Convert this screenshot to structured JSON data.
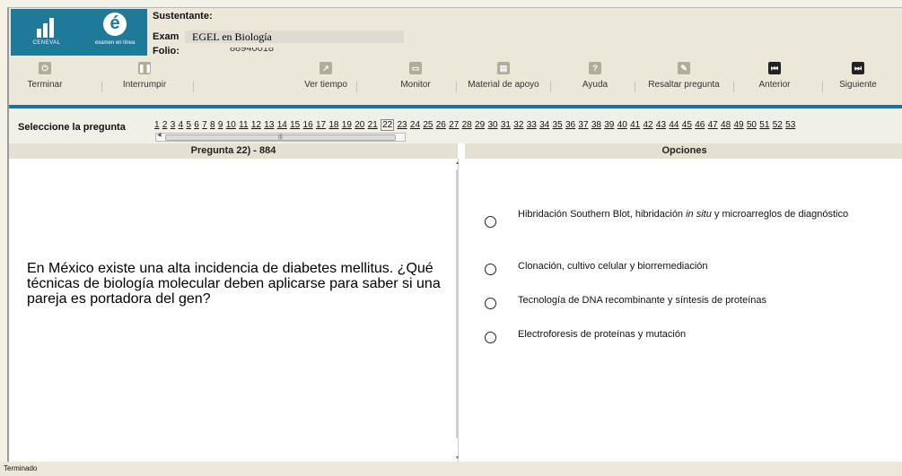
{
  "header": {
    "logo_left_text": "CENEVAL",
    "logo_right_text": "examen en línea",
    "sustentante_label": "Sustentante:",
    "examen_label": "Exam",
    "examen_value": "EGEL en Biología",
    "folio_label": "Folio:",
    "folio_value": "88940018"
  },
  "toolbar": {
    "terminar": "Terminar",
    "interrumpir": "Interrumpir",
    "ver_tiempo": "Ver tiempo",
    "monitor": "Monitor",
    "material": "Material de apoyo",
    "ayuda": "Ayuda",
    "resaltar": "Resaltar pregunta",
    "anterior": "Anterior",
    "siguiente": "Siguiente"
  },
  "question_nav": {
    "label": "Seleccione la pregunta",
    "numbers": [
      "1",
      "2",
      "3",
      "4",
      "5",
      "6",
      "7",
      "8",
      "9",
      "10",
      "11",
      "12",
      "13",
      "14",
      "15",
      "16",
      "17",
      "18",
      "19",
      "20",
      "21",
      "22",
      "23",
      "24",
      "25",
      "26",
      "27",
      "28",
      "29",
      "30",
      "31",
      "32",
      "33",
      "34",
      "35",
      "36",
      "37",
      "38",
      "39",
      "40",
      "41",
      "42",
      "43",
      "44",
      "45",
      "46",
      "47",
      "48",
      "49",
      "50",
      "51",
      "52",
      "53"
    ],
    "current": "22"
  },
  "question": {
    "header": "Pregunta 22) - 884",
    "text": "En México existe una alta incidencia de diabetes mellitus. ¿Qué técnicas de biología molecular deben aplicarse para saber si una pareja es portadora del gen?"
  },
  "options": {
    "header": "Opciones",
    "items": [
      {
        "pre": "Hibridación Southern Blot, hibridación ",
        "em": "in situ",
        "post": " y microarreglos de diagnóstico"
      },
      {
        "pre": "Clonación, cultivo celular y biorremediación",
        "em": "",
        "post": ""
      },
      {
        "pre": "Tecnología de DNA recombinante y síntesis de proteínas",
        "em": "",
        "post": ""
      },
      {
        "pre": "Electroforesis de proteínas y mutación",
        "em": "",
        "post": ""
      }
    ]
  },
  "status_bar": {
    "text": "Terminado"
  }
}
